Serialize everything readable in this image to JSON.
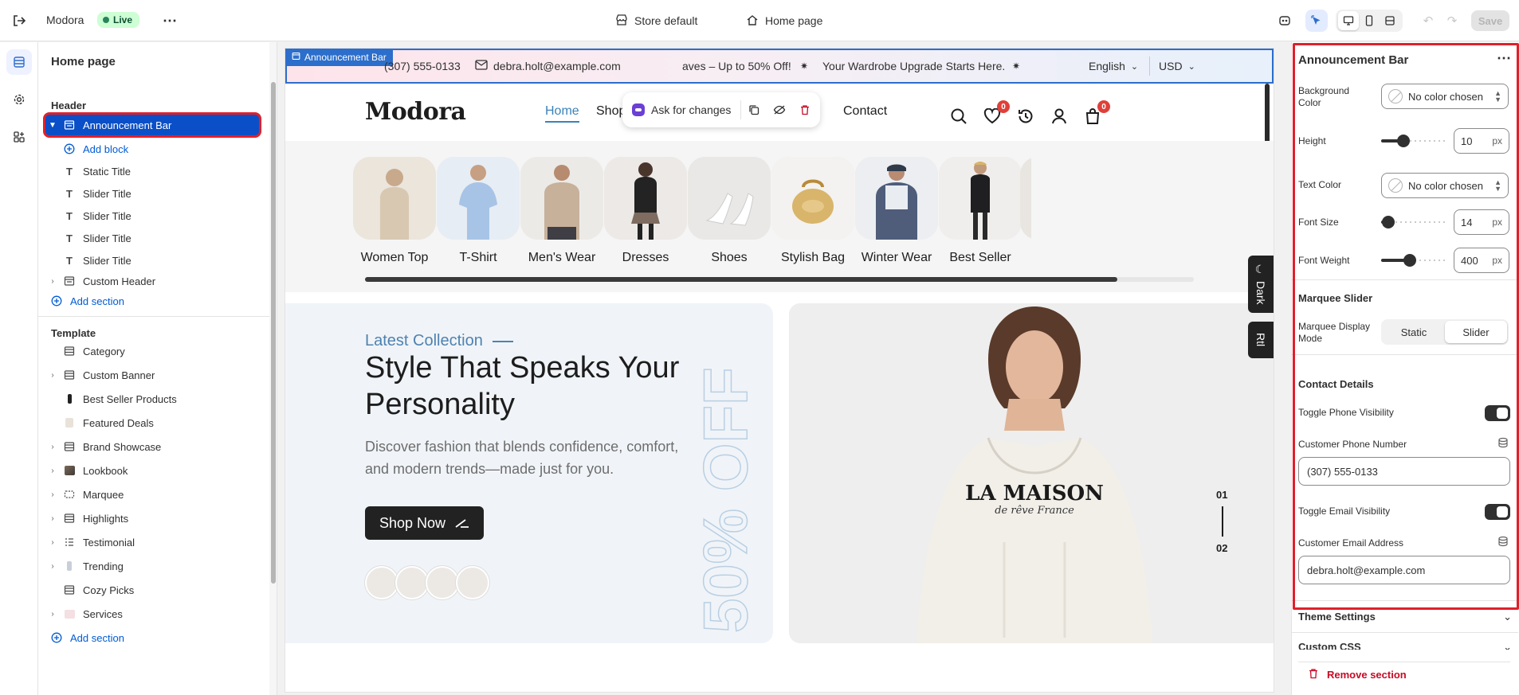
{
  "topbar": {
    "store_name": "Modora",
    "live_badge": "Live",
    "theme_selector": "Store default",
    "page_selector": "Home page",
    "save_label": "Save"
  },
  "left_panel": {
    "title": "Home page",
    "header_group": "Header",
    "header_items": [
      {
        "label": "Announcement Bar",
        "selected": true
      },
      {
        "label": "Add block"
      },
      {
        "label": "Static Title"
      },
      {
        "label": "Slider Title"
      },
      {
        "label": "Slider Title"
      },
      {
        "label": "Slider Title"
      },
      {
        "label": "Slider Title"
      },
      {
        "label": "Custom Header"
      },
      {
        "label": "Add section"
      }
    ],
    "template_group": "Template",
    "template_items": [
      {
        "label": "Category"
      },
      {
        "label": "Custom Banner"
      },
      {
        "label": "Best Seller Products"
      },
      {
        "label": "Featured Deals"
      },
      {
        "label": "Brand Showcase"
      },
      {
        "label": "Lookbook"
      },
      {
        "label": "Marquee"
      },
      {
        "label": "Highlights"
      },
      {
        "label": "Testimonial"
      },
      {
        "label": "Trending"
      },
      {
        "label": "Cozy Picks"
      },
      {
        "label": "Services"
      },
      {
        "label": "Add section"
      }
    ]
  },
  "preview": {
    "section_tag": "Announcement Bar",
    "announcement": {
      "phone": "(307) 555-0133",
      "email": "debra.holt@example.com",
      "marquee_1": "aves – Up to 50% Off!",
      "marquee_2": "Your Wardrobe Upgrade Starts Here.",
      "language": "English",
      "currency": "USD"
    },
    "logo": "Modora",
    "nav": {
      "home": "Home",
      "shop": "Shop",
      "contact": "Contact",
      "ask_for_changes": "Ask for changes",
      "wishlist_count": "0",
      "cart_count": "0"
    },
    "categories": [
      "Women Top",
      "T-Shirt",
      "Men's Wear",
      "Dresses",
      "Shoes",
      "Stylish Bag",
      "Winter Wear",
      "Best Seller"
    ],
    "hero": {
      "eyebrow": "Latest Collection",
      "title": "Style That Speaks Your Personality",
      "description": "Discover fashion that blends confidence, comfort, and modern trends—made just for you.",
      "cta": "Shop Now",
      "watermark": "50% OFF",
      "hoodie_text": "LA MAISON",
      "hoodie_script": "de rêve France",
      "side_dark": "Dark",
      "side_rtl": "Rtl",
      "slide_current": "01",
      "slide_next": "02"
    }
  },
  "right_panel": {
    "title": "Announcement Bar",
    "background_color_label": "Background Color",
    "background_color_value": "No color chosen",
    "height_label": "Height",
    "height_value": "10",
    "height_level": 0.3,
    "text_color_label": "Text Color",
    "text_color_value": "No color chosen",
    "font_size_label": "Font Size",
    "font_size_value": "14",
    "font_size_level": 0.02,
    "font_weight_label": "Font Weight",
    "font_weight_value": "400",
    "font_weight_level": 0.43,
    "unit": "px",
    "marquee_heading": "Marquee Slider",
    "marquee_mode_label": "Marquee Display Mode",
    "marquee_mode_static": "Static",
    "marquee_mode_slider": "Slider",
    "contact_heading": "Contact Details",
    "phone_toggle_label": "Toggle Phone Visibility",
    "phone_field_label": "Customer Phone Number",
    "phone_value": "(307) 555-0133",
    "email_toggle_label": "Toggle Email Visibility",
    "email_field_label": "Customer Email Address",
    "email_value": "debra.holt@example.com",
    "theme_settings": "Theme Settings",
    "custom_css": "Custom CSS",
    "remove_section": "Remove section"
  },
  "colors": {
    "accent": "#2c6ecb",
    "selection": "#0a4fc7",
    "highlight_outline": "#e0202a",
    "live_green": "#29845a",
    "hero_blue": "#4f82b0"
  }
}
